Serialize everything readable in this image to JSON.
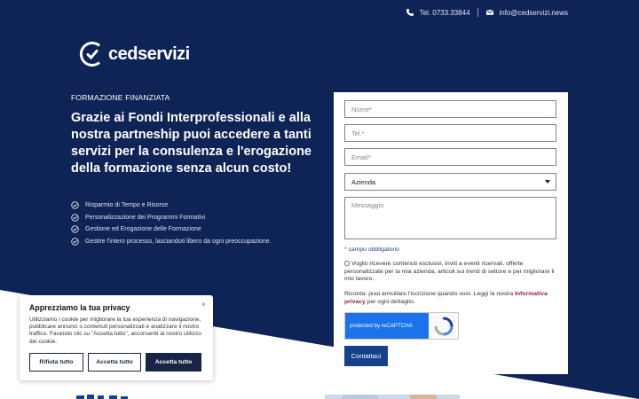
{
  "topbar": {
    "phone": "Tel. 0733.33844",
    "email": "info@cedservizi.news"
  },
  "brand": {
    "name": "cedservizi"
  },
  "hero": {
    "kicker": "FORMAZIONE FINANZIATA",
    "headline": "Grazie ai Fondi Interprofessionali e alla nostra partneship puoi accedere a tanti servizi per la consulenza e l'erogazione della formazione senza alcun costo!",
    "features": [
      "Risparmio di Tempo e Risorse",
      "Personalizzazione dei Programmi Formativi",
      "Gestione ed Erogazione delle Formazione",
      "Gestire l'intero processo, lasciandoti libero da ogni preoccupazione."
    ]
  },
  "form": {
    "name_placeholder": "Nome*",
    "phone_placeholder": "Tel.*",
    "email_placeholder": "Email*",
    "company_selected": "Azienda",
    "message_placeholder": "Messaggio",
    "required_note": "* campo obbligatorio",
    "consent": "Voglio ricevere contenuti esclusivi, inviti a eventi riservati, offerte personalizzate per la mia azienda, articoli sui trend di settore e per migliorare il mio lavoro.",
    "remind_prefix": "Ricorda: puoi annullare l'iscrizione quando vuoi. Leggi la nostra",
    "privacy_link": "Informativa privacy",
    "remind_suffix": "per ogni dettaglio.",
    "captcha_label": "protected by reCAPTCHA",
    "submit_label": "Contattaci"
  },
  "cookie": {
    "title": "Apprezziamo la tua privacy",
    "close": "×",
    "text": "Utilizziamo i cookie per migliorare la tua esperienza di navigazione, pubblicare annunci o contenuti personalizzati e analizzare il nostro traffico. Facendo clic su \"Accetta tutto\", acconsenti al nostro utilizzo dei cookie.",
    "reject_label": "Rifiuta tutto",
    "accept_label": "Accetta tutto",
    "accept_all_label": "Accetta tutto"
  },
  "colors": {
    "hero_bg": "#0f2456",
    "accent": "#14408c",
    "link": "#9b1c4a"
  }
}
